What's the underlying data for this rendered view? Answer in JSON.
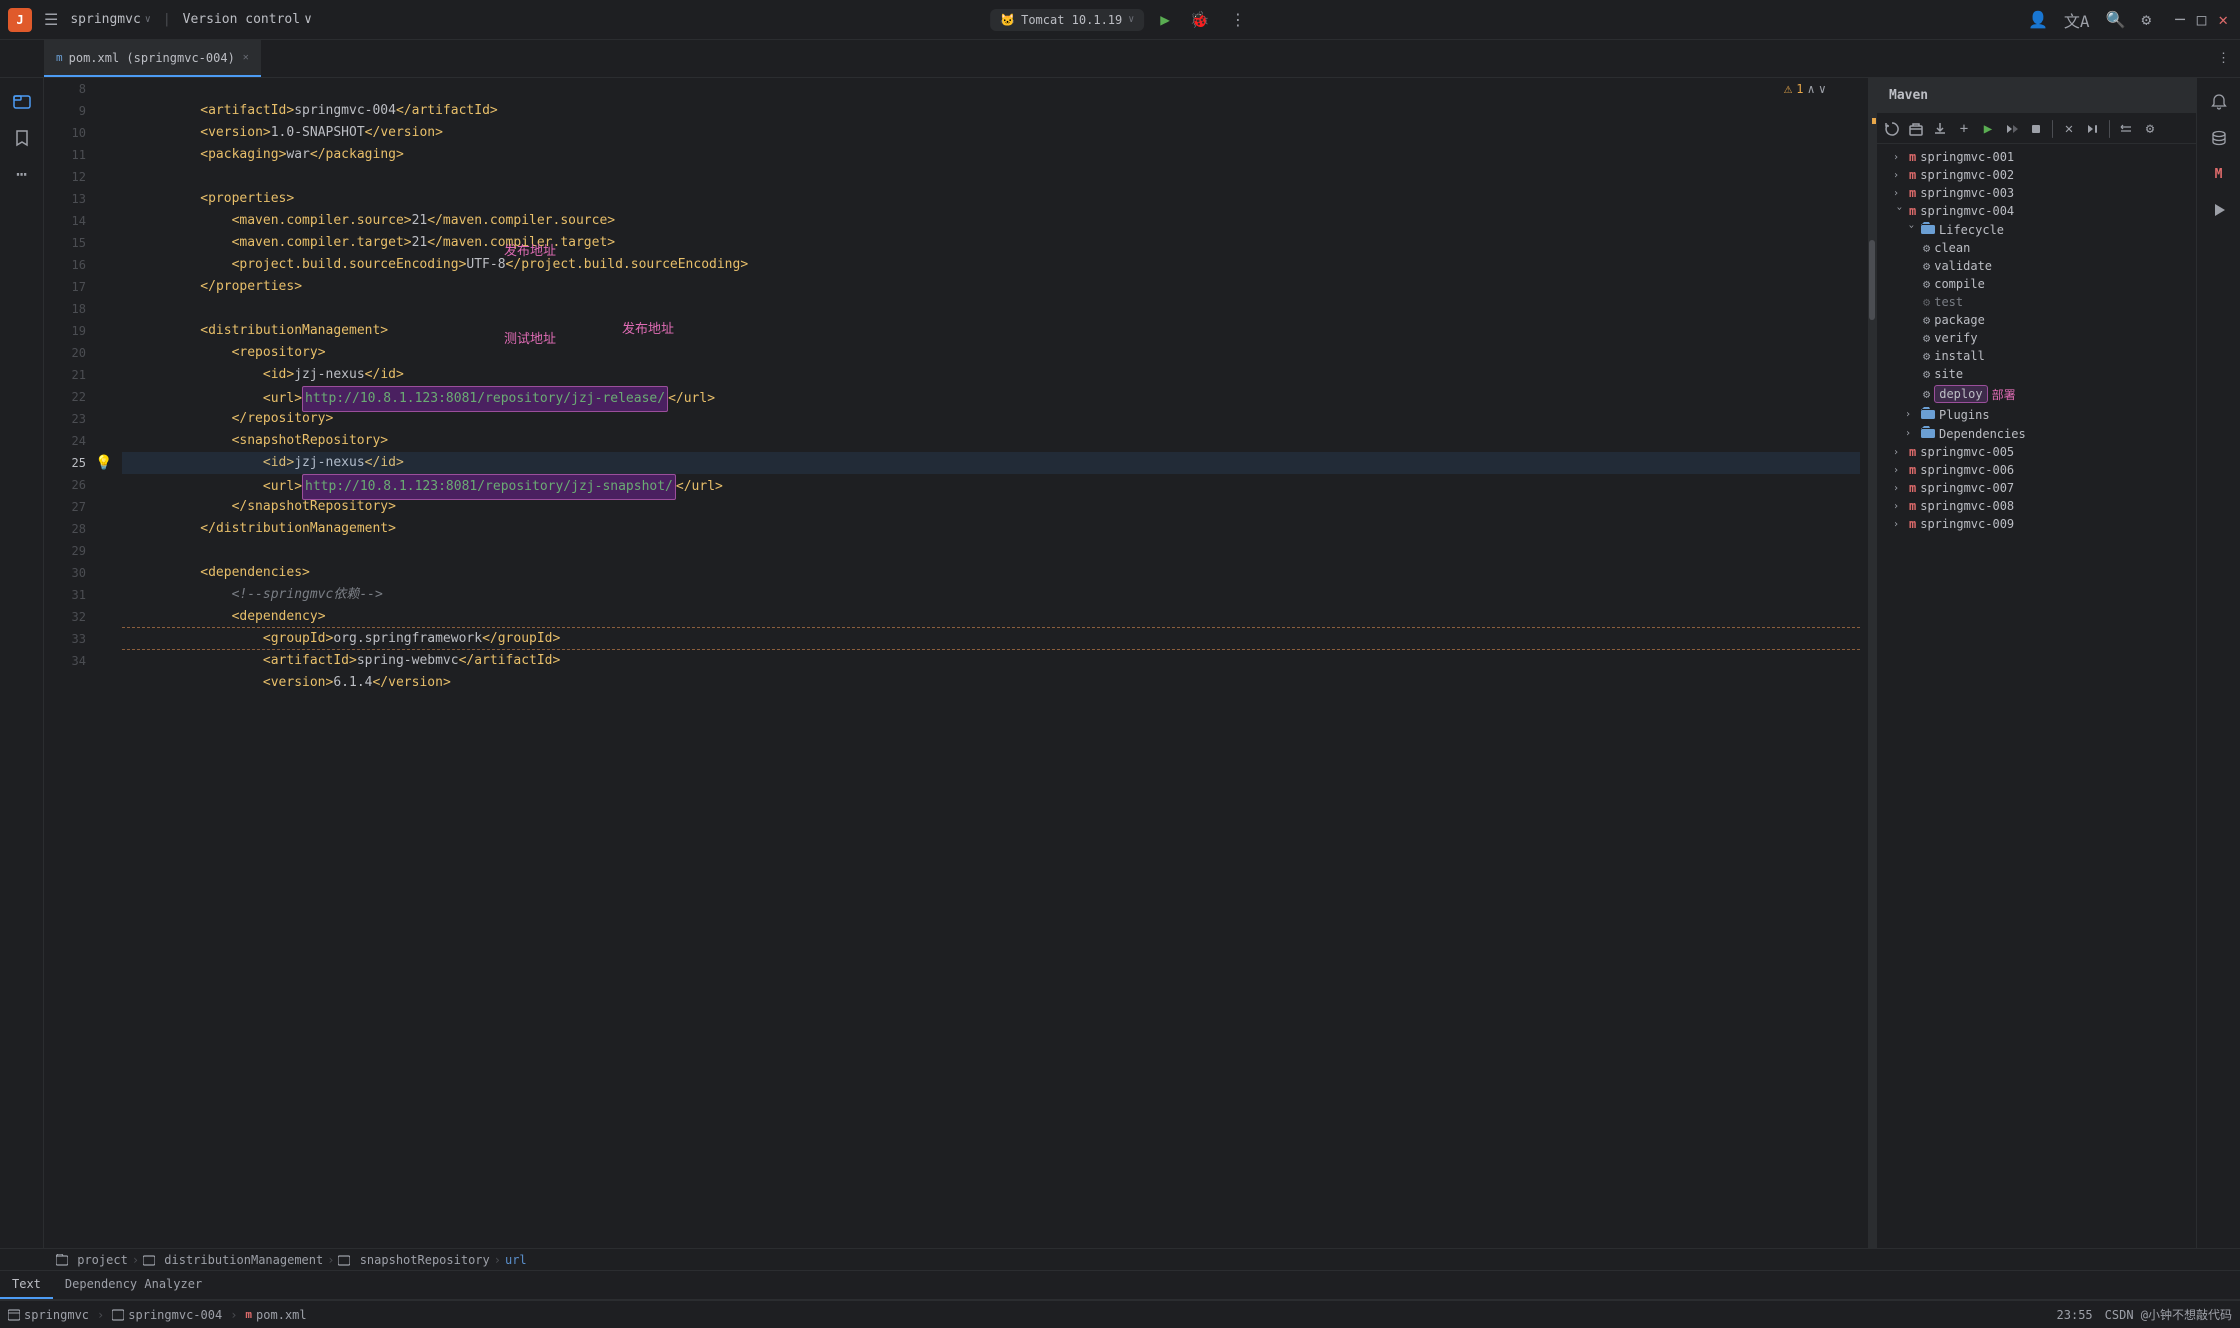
{
  "titleBar": {
    "appIcon": "J",
    "hamburgerLabel": "☰",
    "projectName": "springmvc",
    "projectArrow": "∨",
    "navSeparator": "|",
    "versionControl": "Version control",
    "versionControlArrow": "∨",
    "runConfig": {
      "icon": "🐱",
      "name": "Tomcat 10.1.19",
      "arrow": "∨"
    },
    "actions": {
      "run": "▶",
      "debug": "🐞",
      "more": "⋮",
      "profile": "👤",
      "translate": "翻",
      "search": "🔍",
      "settings": "⚙",
      "minimize": "─",
      "maximize": "□",
      "close": "✕"
    }
  },
  "tab": {
    "icon": "m",
    "label": "pom.xml (springmvc-004)",
    "closeIcon": "✕"
  },
  "editor": {
    "lines": [
      {
        "num": 8,
        "content": "    <artifactId>springmvc-004</artifactId>"
      },
      {
        "num": 9,
        "content": "    <version>1.0-SNAPSHOT</version>"
      },
      {
        "num": 10,
        "content": "    <packaging>war</packaging>"
      },
      {
        "num": 11,
        "content": ""
      },
      {
        "num": 12,
        "content": "    <properties>"
      },
      {
        "num": 13,
        "content": "        <maven.compiler.source>21</maven.compiler.source>"
      },
      {
        "num": 14,
        "content": "        <maven.compiler.target>21</maven.compiler.target>"
      },
      {
        "num": 15,
        "content": "        <project.build.sourceEncoding>UTF-8</project.build.sourceEncoding>"
      },
      {
        "num": 16,
        "content": "    </properties>"
      },
      {
        "num": 17,
        "content": ""
      },
      {
        "num": 18,
        "content": "    <distributionManagement>"
      },
      {
        "num": 19,
        "content": "        <repository>"
      },
      {
        "num": 20,
        "content": "            <id>jzj-nexus</id>"
      },
      {
        "num": 21,
        "content": "            <url>http://10.8.1.123:8081/repository/jzj-release/</url>"
      },
      {
        "num": 22,
        "content": "        </repository>"
      },
      {
        "num": 23,
        "content": "        <snapshotRepository>"
      },
      {
        "num": 24,
        "content": "            <id>jzj-nexus</id>"
      },
      {
        "num": 25,
        "content": "            <url>http://10.8.1.123:8081/repository/jzj-snapshot/</url>"
      },
      {
        "num": 26,
        "content": "        </snapshotRepository>"
      },
      {
        "num": 27,
        "content": "    </distributionManagement>"
      },
      {
        "num": 28,
        "content": ""
      },
      {
        "num": 29,
        "content": "    <dependencies>"
      },
      {
        "num": 30,
        "content": "        <!--springmvc依赖-->"
      },
      {
        "num": 31,
        "content": "        <dependency>"
      },
      {
        "num": 32,
        "content": "            <groupId>org.springframework</groupId>"
      },
      {
        "num": 33,
        "content": "            <artifactId>spring-webmvc</artifactId>"
      },
      {
        "num": 34,
        "content": "            <version>6.1.4</version>"
      }
    ],
    "annotations": {
      "publish": "发布地址",
      "test": "测试地址"
    },
    "warningCount": "1"
  },
  "maven": {
    "title": "Maven",
    "toolbar": {
      "refresh": "↻",
      "open": "📁",
      "download": "⬇",
      "add": "+",
      "run": "▶",
      "run2": "▶▶",
      "stop": "⏹",
      "close": "✕",
      "skip": "⏭",
      "collapse": "≡",
      "settings": "⚙"
    },
    "projects": [
      {
        "label": "springmvc-001",
        "expanded": false
      },
      {
        "label": "springmvc-002",
        "expanded": false
      },
      {
        "label": "springmvc-003",
        "expanded": false
      },
      {
        "label": "springmvc-004",
        "expanded": true,
        "children": [
          {
            "type": "lifecycle",
            "label": "Lifecycle",
            "expanded": true,
            "children": [
              {
                "type": "goal",
                "label": "clean"
              },
              {
                "type": "goal",
                "label": "validate"
              },
              {
                "type": "goal",
                "label": "compile"
              },
              {
                "type": "goal",
                "label": "test",
                "dimmed": true
              },
              {
                "type": "goal",
                "label": "package"
              },
              {
                "type": "goal",
                "label": "verify"
              },
              {
                "type": "goal",
                "label": "install"
              },
              {
                "type": "goal",
                "label": "site"
              },
              {
                "type": "goal",
                "label": "deploy",
                "highlighted": true
              }
            ]
          },
          {
            "type": "folder",
            "label": "Plugins"
          },
          {
            "type": "folder",
            "label": "Dependencies"
          }
        ]
      },
      {
        "label": "springmvc-005",
        "expanded": false
      },
      {
        "label": "springmvc-006",
        "expanded": false
      },
      {
        "label": "springmvc-007",
        "expanded": false
      },
      {
        "label": "springmvc-008",
        "expanded": false
      },
      {
        "label": "springmvc-009",
        "expanded": false
      }
    ],
    "deployAnnotation": "部署"
  },
  "breadcrumb": {
    "items": [
      {
        "label": "project",
        "type": "plain"
      },
      {
        "sep": "›"
      },
      {
        "label": "distributionManagement",
        "type": "plain"
      },
      {
        "sep": "›"
      },
      {
        "label": "snapshotRepository",
        "type": "plain"
      },
      {
        "sep": "›"
      },
      {
        "label": "url",
        "type": "plain"
      }
    ]
  },
  "bottomTabs": [
    {
      "label": "Text",
      "active": true
    },
    {
      "label": "Dependency Analyzer",
      "active": false
    }
  ],
  "statusBar": {
    "left": [
      {
        "icon": "□",
        "label": "springmvc"
      },
      {
        "sep": "›"
      },
      {
        "icon": "□",
        "label": "springmvc-004"
      },
      {
        "sep": "›"
      },
      {
        "icon": "m",
        "label": "pom.xml"
      }
    ],
    "right": {
      "time": "23:55",
      "csdn": "CSDN @小钟不想敲代码"
    }
  },
  "sidebar": {
    "left": [
      {
        "icon": "📁",
        "name": "project-icon"
      },
      {
        "icon": "⚙",
        "name": "structure-icon"
      },
      {
        "icon": "⋯",
        "name": "more-icon"
      }
    ],
    "right": [
      {
        "icon": "🔔",
        "name": "notifications-icon"
      },
      {
        "icon": "🗄",
        "name": "database-icon"
      },
      {
        "icon": "M",
        "name": "maven-right-icon"
      },
      {
        "icon": "⚡",
        "name": "run-icon"
      }
    ]
  }
}
